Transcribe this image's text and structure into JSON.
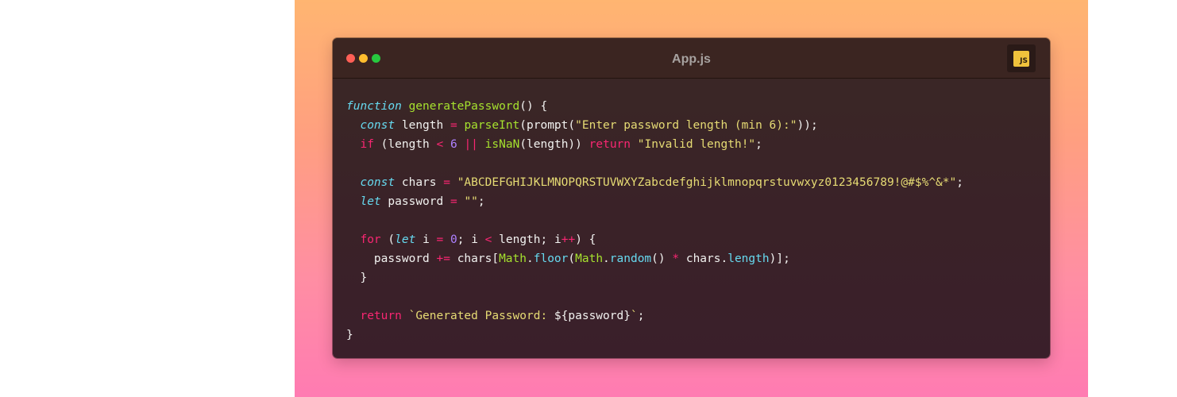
{
  "window": {
    "filename": "App.js",
    "language_badge": "JS"
  },
  "code_lines": [
    [
      {
        "t": "function",
        "c": "kw-i"
      },
      {
        "t": " "
      },
      {
        "t": "generatePassword",
        "c": "fn"
      },
      {
        "t": "() {"
      }
    ],
    [
      {
        "t": "  "
      },
      {
        "t": "const",
        "c": "kw-i"
      },
      {
        "t": " length "
      },
      {
        "t": "=",
        "c": "op"
      },
      {
        "t": " "
      },
      {
        "t": "parseInt",
        "c": "fn"
      },
      {
        "t": "(prompt("
      },
      {
        "t": "\"Enter password length (min 6):\"",
        "c": "str"
      },
      {
        "t": "));"
      }
    ],
    [
      {
        "t": "  "
      },
      {
        "t": "if",
        "c": "kw"
      },
      {
        "t": " (length "
      },
      {
        "t": "<",
        "c": "op"
      },
      {
        "t": " "
      },
      {
        "t": "6",
        "c": "num"
      },
      {
        "t": " "
      },
      {
        "t": "||",
        "c": "op"
      },
      {
        "t": " "
      },
      {
        "t": "isNaN",
        "c": "fn"
      },
      {
        "t": "(length)) "
      },
      {
        "t": "return",
        "c": "kw"
      },
      {
        "t": " "
      },
      {
        "t": "\"Invalid length!\"",
        "c": "str"
      },
      {
        "t": ";"
      }
    ],
    [],
    [
      {
        "t": "  "
      },
      {
        "t": "const",
        "c": "kw-i"
      },
      {
        "t": " chars "
      },
      {
        "t": "=",
        "c": "op"
      },
      {
        "t": " "
      },
      {
        "t": "\"ABCDEFGHIJKLMNOPQRSTUVWXYZabcdefghijklmnopqrstuvwxyz0123456789!@#$%^&*\"",
        "c": "str"
      },
      {
        "t": ";"
      }
    ],
    [
      {
        "t": "  "
      },
      {
        "t": "let",
        "c": "kw-i"
      },
      {
        "t": " password "
      },
      {
        "t": "=",
        "c": "op"
      },
      {
        "t": " "
      },
      {
        "t": "\"\"",
        "c": "str"
      },
      {
        "t": ";"
      }
    ],
    [],
    [
      {
        "t": "  "
      },
      {
        "t": "for",
        "c": "kw"
      },
      {
        "t": " ("
      },
      {
        "t": "let",
        "c": "kw-i"
      },
      {
        "t": " i "
      },
      {
        "t": "=",
        "c": "op"
      },
      {
        "t": " "
      },
      {
        "t": "0",
        "c": "num"
      },
      {
        "t": "; i "
      },
      {
        "t": "<",
        "c": "op"
      },
      {
        "t": " length; i"
      },
      {
        "t": "++",
        "c": "op"
      },
      {
        "t": ") {"
      }
    ],
    [
      {
        "t": "    password "
      },
      {
        "t": "+=",
        "c": "op"
      },
      {
        "t": " chars["
      },
      {
        "t": "Math",
        "c": "fn"
      },
      {
        "t": "."
      },
      {
        "t": "floor",
        "c": "prop"
      },
      {
        "t": "("
      },
      {
        "t": "Math",
        "c": "fn"
      },
      {
        "t": "."
      },
      {
        "t": "random",
        "c": "prop"
      },
      {
        "t": "() "
      },
      {
        "t": "*",
        "c": "op"
      },
      {
        "t": " chars."
      },
      {
        "t": "length",
        "c": "prop"
      },
      {
        "t": ")];"
      }
    ],
    [
      {
        "t": "  }"
      }
    ],
    [],
    [
      {
        "t": "  "
      },
      {
        "t": "return",
        "c": "kw"
      },
      {
        "t": " "
      },
      {
        "t": "`Generated Password: ",
        "c": "str"
      },
      {
        "t": "${password}"
      },
      {
        "t": "`",
        "c": "str"
      },
      {
        "t": ";"
      }
    ],
    [
      {
        "t": "}"
      }
    ]
  ]
}
